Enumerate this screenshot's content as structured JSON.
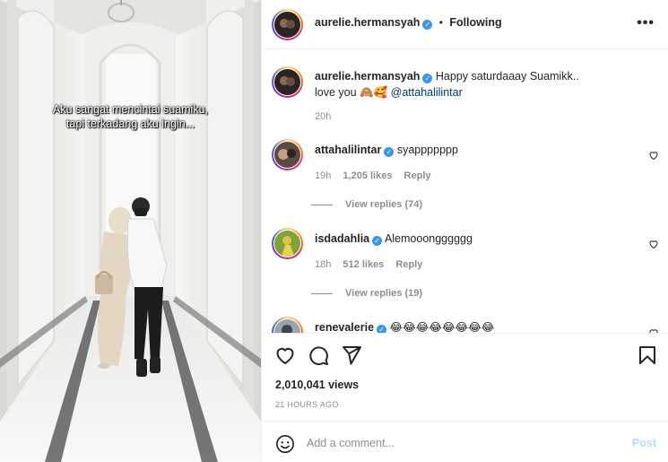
{
  "media": {
    "caption_line1": "Aku sangat mencintai suamiku,",
    "caption_line2": "tapi terkadang aku ingin..."
  },
  "header": {
    "username": "aurelie.hermansyah",
    "separator": "•",
    "follow_status": "Following",
    "more_icon": "more-horizontal-icon"
  },
  "post": {
    "username": "aurelie.hermansyah",
    "caption_text": "Happy saturdaaay Suamikk..",
    "caption_line2": "love you 🙈🥰",
    "mention": "@attahalilintar",
    "time": "20h"
  },
  "comments": [
    {
      "username": "attahalilintar",
      "text": "syappppppp",
      "time": "19h",
      "likes": "1,205 likes",
      "reply": "Reply",
      "view_replies": "View replies (74)"
    },
    {
      "username": "isdadahlia",
      "text": "Alemooongggggg",
      "time": "18h",
      "likes": "512 likes",
      "reply": "Reply",
      "view_replies": "View replies (19)"
    },
    {
      "username": "renevalerie",
      "text": "😂😂😂😂😂😂😂😂"
    }
  ],
  "actions": {
    "like_icon": "heart-icon",
    "comment_icon": "comment-icon",
    "share_icon": "paper-plane-icon",
    "save_icon": "bookmark-icon",
    "views": "2,010,041 views",
    "posted_ago": "21 HOURS AGO"
  },
  "add_comment": {
    "placeholder": "Add a comment...",
    "post_label": "Post",
    "emoji_icon": "smiley-icon"
  },
  "colors": {
    "verified": "#3897f0",
    "mention": "#00376b",
    "post_disabled": "#b2dffc",
    "muted": "#8e8e8e"
  }
}
